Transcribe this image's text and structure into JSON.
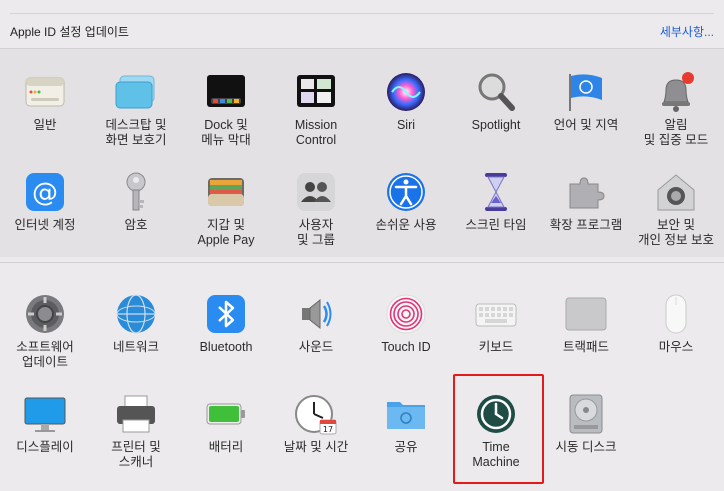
{
  "banner": {
    "title": "Apple ID 설정 업데이트",
    "details_link": "세부사항..."
  },
  "highlighted_item": "Time Machine",
  "sections": [
    {
      "rows": [
        [
          {
            "name": "general",
            "label": "일반",
            "icon": "general-icon"
          },
          {
            "name": "desktop-screensaver",
            "label": "데스크탑 및\n화면 보호기",
            "icon": "desktop-icon"
          },
          {
            "name": "dock-menubar",
            "label": "Dock 및\n메뉴 막대",
            "icon": "dock-icon"
          },
          {
            "name": "mission-control",
            "label": "Mission\nControl",
            "icon": "mission-control-icon"
          },
          {
            "name": "siri",
            "label": "Siri",
            "icon": "siri-icon"
          },
          {
            "name": "spotlight",
            "label": "Spotlight",
            "icon": "spotlight-icon"
          },
          {
            "name": "language-region",
            "label": "언어 및 지역",
            "icon": "flag-icon"
          },
          {
            "name": "notifications-focus",
            "label": "알림\n및 집중 모드",
            "icon": "bell-icon"
          }
        ],
        [
          {
            "name": "internet-accounts",
            "label": "인터넷 계정",
            "icon": "at-icon"
          },
          {
            "name": "passwords",
            "label": "암호",
            "icon": "key-icon"
          },
          {
            "name": "wallet-applepay",
            "label": "지갑 및\nApple Pay",
            "icon": "wallet-icon"
          },
          {
            "name": "users-groups",
            "label": "사용자\n및 그룹",
            "icon": "users-icon"
          },
          {
            "name": "accessibility",
            "label": "손쉬운 사용",
            "icon": "accessibility-icon"
          },
          {
            "name": "screen-time",
            "label": "스크린 타임",
            "icon": "hourglass-icon"
          },
          {
            "name": "extensions",
            "label": "확장 프로그램",
            "icon": "puzzle-icon"
          },
          {
            "name": "security-privacy",
            "label": "보안 및\n개인 정보 보호",
            "icon": "house-lock-icon"
          }
        ]
      ]
    },
    {
      "rows": [
        [
          {
            "name": "software-update",
            "label": "소프트웨어\n업데이트",
            "icon": "gear-icon"
          },
          {
            "name": "network",
            "label": "네트워크",
            "icon": "globe-icon"
          },
          {
            "name": "bluetooth",
            "label": "Bluetooth",
            "icon": "bluetooth-icon"
          },
          {
            "name": "sound",
            "label": "사운드",
            "icon": "speaker-icon"
          },
          {
            "name": "touch-id",
            "label": "Touch ID",
            "icon": "fingerprint-icon"
          },
          {
            "name": "keyboard",
            "label": "키보드",
            "icon": "keyboard-icon"
          },
          {
            "name": "trackpad",
            "label": "트랙패드",
            "icon": "trackpad-icon"
          },
          {
            "name": "mouse",
            "label": "마우스",
            "icon": "mouse-icon"
          }
        ],
        [
          {
            "name": "displays",
            "label": "디스플레이",
            "icon": "display-icon"
          },
          {
            "name": "printers-scanners",
            "label": "프린터 및\n스캐너",
            "icon": "printer-icon"
          },
          {
            "name": "battery",
            "label": "배터리",
            "icon": "battery-icon"
          },
          {
            "name": "date-time",
            "label": "날짜 및 시간",
            "icon": "clock-icon"
          },
          {
            "name": "sharing",
            "label": "공유",
            "icon": "folder-icon"
          },
          {
            "name": "time-machine",
            "label": "Time\nMachine",
            "icon": "time-machine-icon"
          },
          {
            "name": "startup-disk",
            "label": "시동 디스크",
            "icon": "disk-icon"
          }
        ]
      ]
    }
  ],
  "accent_color": "#1f5fd6",
  "highlight_color": "#e21a1a"
}
